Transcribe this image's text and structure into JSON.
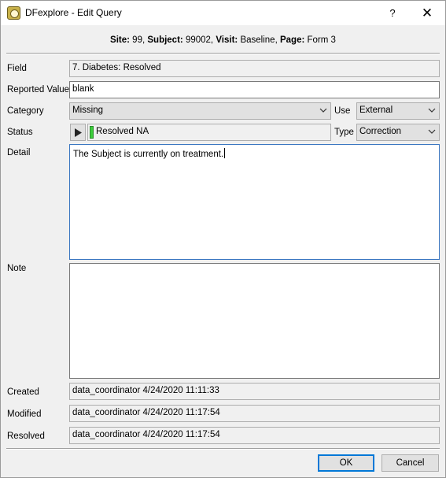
{
  "window": {
    "title": "DFexplore - Edit Query",
    "help_glyph": "?",
    "close_glyph": "✕"
  },
  "context": {
    "site_label": "Site:",
    "site_value": "99,",
    "subject_label": "Subject:",
    "subject_value": "99002,",
    "visit_label": "Visit:",
    "visit_value": "Baseline,",
    "page_label": "Page:",
    "page_value": "Form 3"
  },
  "form": {
    "field_label": "Field",
    "field_value": "7. Diabetes: Resolved",
    "reported_label": "Reported Value",
    "reported_value": "blank",
    "category_label": "Category",
    "category_value": "Missing",
    "use_label": "Use",
    "use_value": "External",
    "status_label": "Status",
    "status_value": "Resolved NA",
    "type_label": "Type",
    "type_value": "Correction",
    "detail_label": "Detail",
    "detail_value": "The Subject is currently on treatment.",
    "note_label": "Note",
    "note_value": ""
  },
  "audit": {
    "created_label": "Created",
    "created_value": "data_coordinator 4/24/2020 11:11:33",
    "modified_label": "Modified",
    "modified_value": "data_coordinator 4/24/2020 11:17:54",
    "resolved_label": "Resolved",
    "resolved_value": "data_coordinator 4/24/2020 11:17:54"
  },
  "buttons": {
    "ok_label": "OK",
    "cancel_label": "Cancel"
  },
  "icons": {
    "app": "dfexplore-app-icon",
    "play": "play-icon",
    "dropdown": "chevron-down-icon",
    "status_indicator": "green-status-led"
  },
  "colors": {
    "status_led": "#3ccf3c",
    "focus_border": "#3c78c2",
    "default_button_border": "#0078d7"
  }
}
